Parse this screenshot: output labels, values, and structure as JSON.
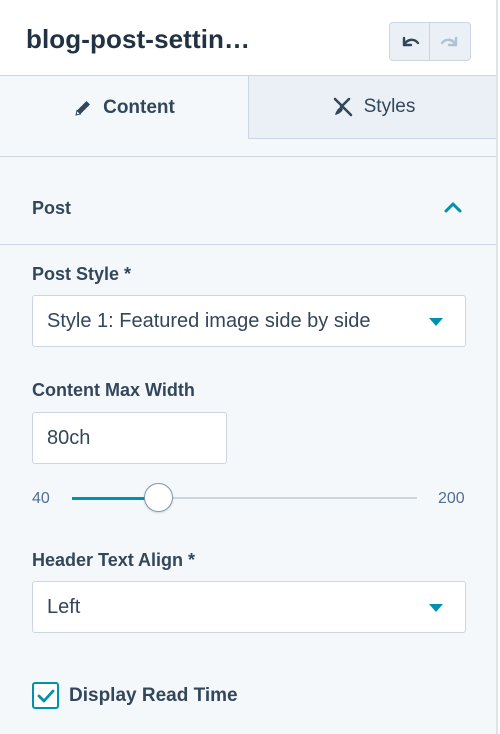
{
  "header": {
    "title": "blog-post-settin…",
    "undo_icon": "undo-icon",
    "redo_icon": "redo-icon"
  },
  "tabs": [
    {
      "label": "Content",
      "icon": "pencil-icon",
      "active": true
    },
    {
      "label": "Styles",
      "icon": "brush-icon",
      "active": false
    }
  ],
  "section": {
    "title": "Post",
    "expanded": true
  },
  "fields": {
    "post_style": {
      "label": "Post Style *",
      "value": "Style 1: Featured image side by side"
    },
    "content_max_width": {
      "label": "Content Max Width",
      "value": "80ch",
      "slider_min": "40",
      "slider_max": "200",
      "slider_value": 80
    },
    "header_text_align": {
      "label": "Header Text Align *",
      "value": "Left"
    },
    "display_read_time": {
      "label": "Display Read Time",
      "checked": true
    }
  },
  "colors": {
    "accent": "#0091ae",
    "text": "#33475b",
    "border": "#cbd6e2",
    "panel_bg": "#f5f8fa"
  }
}
